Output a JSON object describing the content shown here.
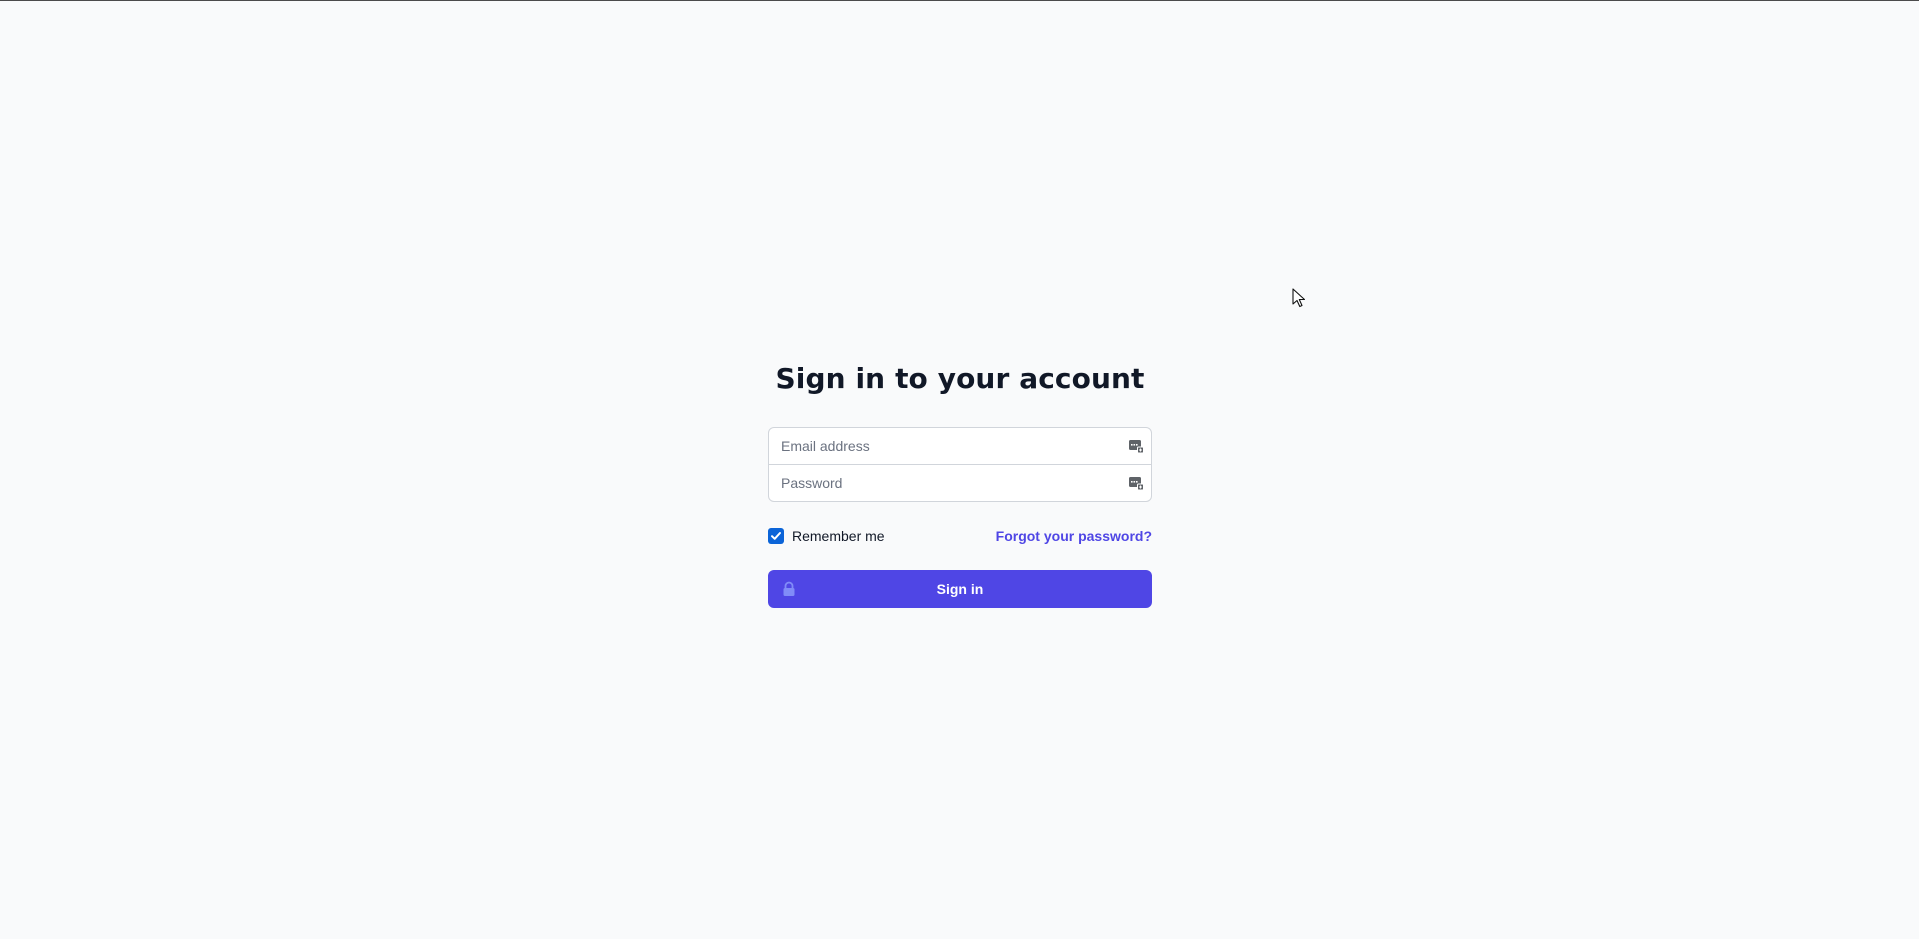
{
  "page": {
    "title": "Sign in to your account"
  },
  "form": {
    "email": {
      "placeholder": "Email address",
      "value": "",
      "icon": "autofill-icon"
    },
    "password": {
      "placeholder": "Password",
      "value": "",
      "icon": "autofill-icon"
    },
    "remember": {
      "label": "Remember me",
      "checked": true
    },
    "forgot_link": "Forgot your password?",
    "submit": {
      "label": "Sign in",
      "icon": "lock-icon"
    }
  },
  "colors": {
    "background": "#f9fafb",
    "accent": "#4f46e5",
    "checkbox": "#0b64d8",
    "text": "#111827",
    "placeholder": "#6b7280"
  }
}
